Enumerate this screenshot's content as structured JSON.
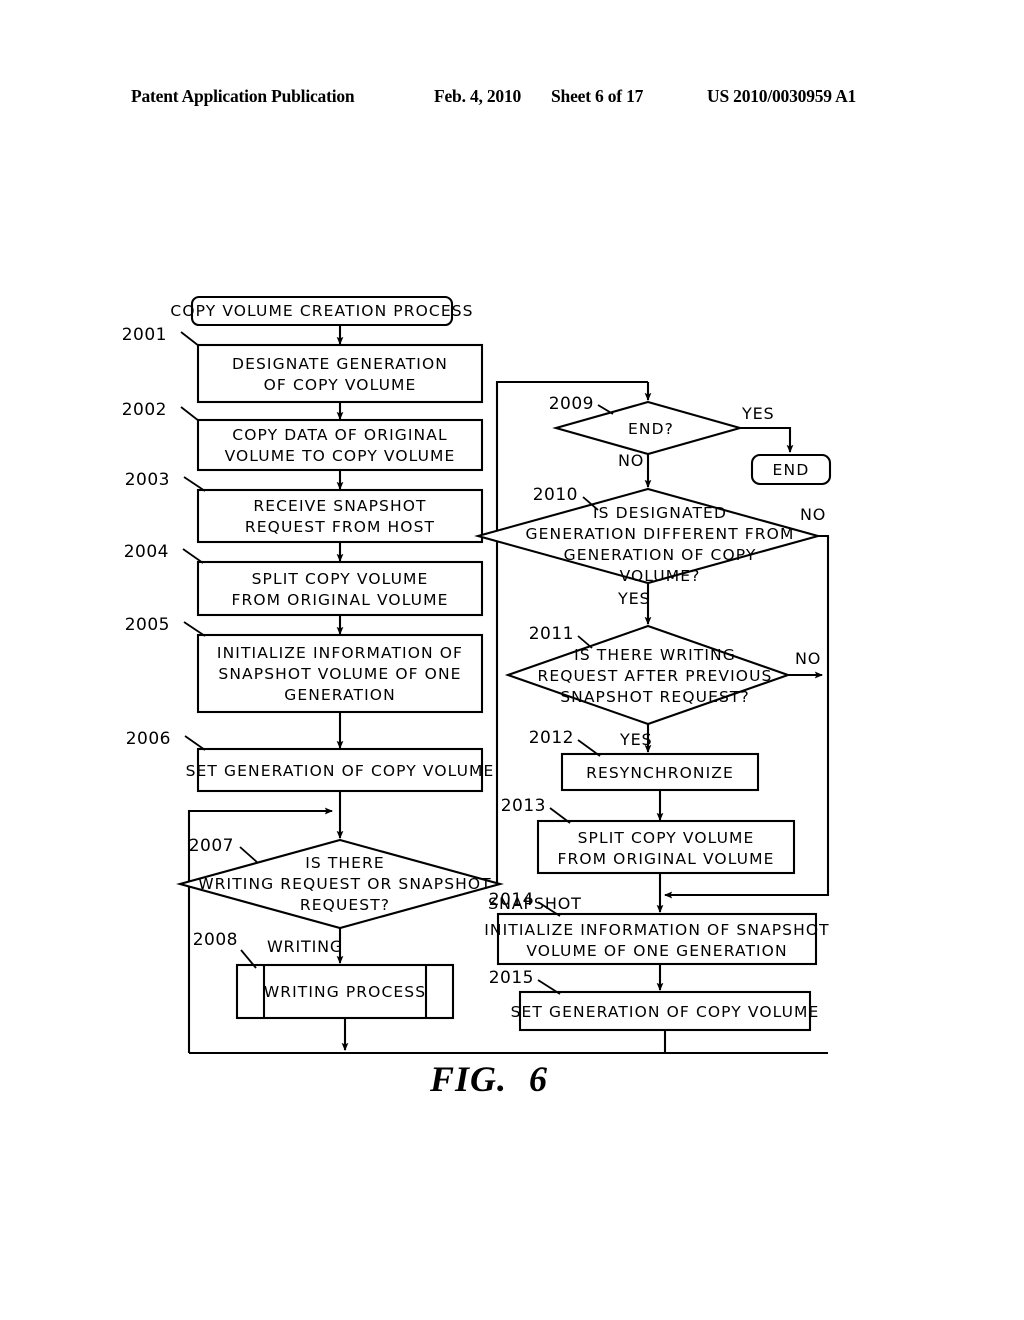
{
  "header": {
    "publication": "Patent Application Publication",
    "date": "Feb. 4, 2010",
    "sheet": "Sheet 6 of 17",
    "number": "US 2010/0030959 A1"
  },
  "figure": {
    "caption_label": "FIG.",
    "caption_number": "6"
  },
  "flowchart": {
    "title_box": "COPY VOLUME CREATION PROCESS",
    "end_terminator": "END",
    "steps": {
      "s2001": {
        "ref": "2001",
        "line1": "DESIGNATE GENERATION",
        "line2": "OF COPY VOLUME"
      },
      "s2002": {
        "ref": "2002",
        "line1": "COPY DATA OF ORIGINAL",
        "line2": "VOLUME TO COPY VOLUME"
      },
      "s2003": {
        "ref": "2003",
        "line1": "RECEIVE SNAPSHOT",
        "line2": "REQUEST FROM HOST"
      },
      "s2004": {
        "ref": "2004",
        "line1": "SPLIT COPY VOLUME",
        "line2": "FROM ORIGINAL VOLUME"
      },
      "s2005": {
        "ref": "2005",
        "line1": "INITIALIZE INFORMATION OF",
        "line2": "SNAPSHOT VOLUME OF ONE",
        "line3": "GENERATION"
      },
      "s2006": {
        "ref": "2006",
        "line1": "SET GENERATION OF COPY VOLUME"
      },
      "s2007": {
        "ref": "2007",
        "line1": "IS THERE",
        "line2": "WRITING REQUEST OR SNAPSHOT",
        "line3": "REQUEST?",
        "branch_a": "WRITING",
        "branch_b": "SNAPSHOT"
      },
      "s2008": {
        "ref": "2008",
        "line1": "WRITING PROCESS"
      },
      "s2009": {
        "ref": "2009",
        "line1": "END?",
        "branch_yes": "YES",
        "branch_no": "NO"
      },
      "s2010": {
        "ref": "2010",
        "line1": "IS DESIGNATED",
        "line2": "GENERATION DIFFERENT FROM",
        "line3": "GENERATION OF COPY",
        "line4": "VOLUME?",
        "branch_yes": "YES",
        "branch_no": "NO"
      },
      "s2011": {
        "ref": "2011",
        "line1": "IS THERE WRITING",
        "line2": "REQUEST AFTER PREVIOUS",
        "line3": "SNAPSHOT REQUEST?",
        "branch_yes": "YES",
        "branch_no": "NO"
      },
      "s2012": {
        "ref": "2012",
        "line1": "RESYNCHRONIZE"
      },
      "s2013": {
        "ref": "2013",
        "line1": "SPLIT COPY VOLUME",
        "line2": "FROM ORIGINAL VOLUME"
      },
      "s2014": {
        "ref": "2014",
        "line1": "INITIALIZE INFORMATION OF SNAPSHOT",
        "line2": "VOLUME OF ONE GENERATION"
      },
      "s2015": {
        "ref": "2015",
        "line1": "SET GENERATION OF COPY VOLUME"
      }
    }
  },
  "colors": {
    "ink": "#000000",
    "paper": "#ffffff"
  }
}
